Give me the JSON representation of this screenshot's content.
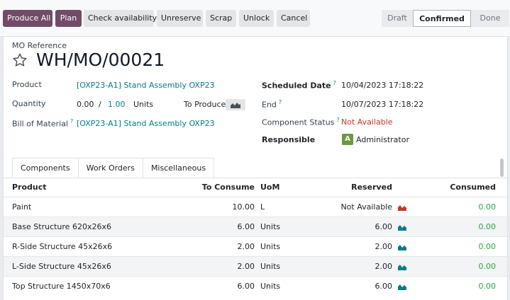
{
  "toolbar": {
    "produce_all": "Produce All",
    "plan": "Plan",
    "check_availability": "Check availability",
    "unreserve": "Unreserve",
    "scrap": "Scrap",
    "unlock": "Unlock",
    "cancel": "Cancel"
  },
  "status": {
    "stages": [
      "Draft",
      "Confirmed",
      "Done"
    ],
    "active": "Confirmed"
  },
  "header": {
    "caption": "MO Reference",
    "title": "WH/MO/00021"
  },
  "fields": {
    "product_label": "Product",
    "product_value": "[OXP23-A1] Stand Assembly OXP23",
    "quantity_label": "Quantity",
    "quantity_done": "0.00",
    "quantity_sep": "/",
    "quantity_total": "1.00",
    "quantity_uom": "Units",
    "to_produce_label": "To Produce",
    "bom_label": "Bill of Material",
    "bom_help": "?",
    "bom_value": "[OXP23-A1] Stand Assembly OXP23",
    "scheduled_label": "Scheduled Date",
    "scheduled_help": "?",
    "scheduled_value": "10/04/2023 17:18:22",
    "end_label": "End",
    "end_help": "?",
    "end_value": "10/07/2023 17:18:22",
    "component_status_label": "Component Status",
    "component_status_help": "?",
    "component_status_value": "Not Available",
    "responsible_label": "Responsible",
    "responsible_initial": "A",
    "responsible_value": "Administrator"
  },
  "tabs": [
    "Components",
    "Work Orders",
    "Miscellaneous"
  ],
  "table": {
    "columns": {
      "product": "Product",
      "to_consume": "To Consume",
      "uom": "UoM",
      "reserved": "Reserved",
      "consumed": "Consumed"
    },
    "rows": [
      {
        "product": "Paint",
        "to_consume": "10.00",
        "uom": "L",
        "reserved": "Not Available",
        "consumed": "0.00",
        "reserved_state": "danger"
      },
      {
        "product": "Base Structure 620x26x6",
        "to_consume": "6.00",
        "uom": "Units",
        "reserved": "6.00",
        "consumed": "0.00",
        "reserved_state": "ok"
      },
      {
        "product": "R-Side Structure 45x26x6",
        "to_consume": "2.00",
        "uom": "Units",
        "reserved": "2.00",
        "consumed": "0.00",
        "reserved_state": "ok"
      },
      {
        "product": "L-Side Structure 45x26x6",
        "to_consume": "2.00",
        "uom": "Units",
        "reserved": "2.00",
        "consumed": "0.00",
        "reserved_state": "ok"
      },
      {
        "product": "Top Structure 1450x70x6",
        "to_consume": "6.00",
        "uom": "Units",
        "reserved": "6.00",
        "consumed": "0.00",
        "reserved_state": "ok"
      }
    ]
  },
  "colors": {
    "primary": "#714b67",
    "link": "#017e84",
    "danger": "#c0392b",
    "success": "#28a745"
  },
  "icons": {
    "favorite": "star-outline-icon",
    "forecast": "area-chart-icon"
  }
}
